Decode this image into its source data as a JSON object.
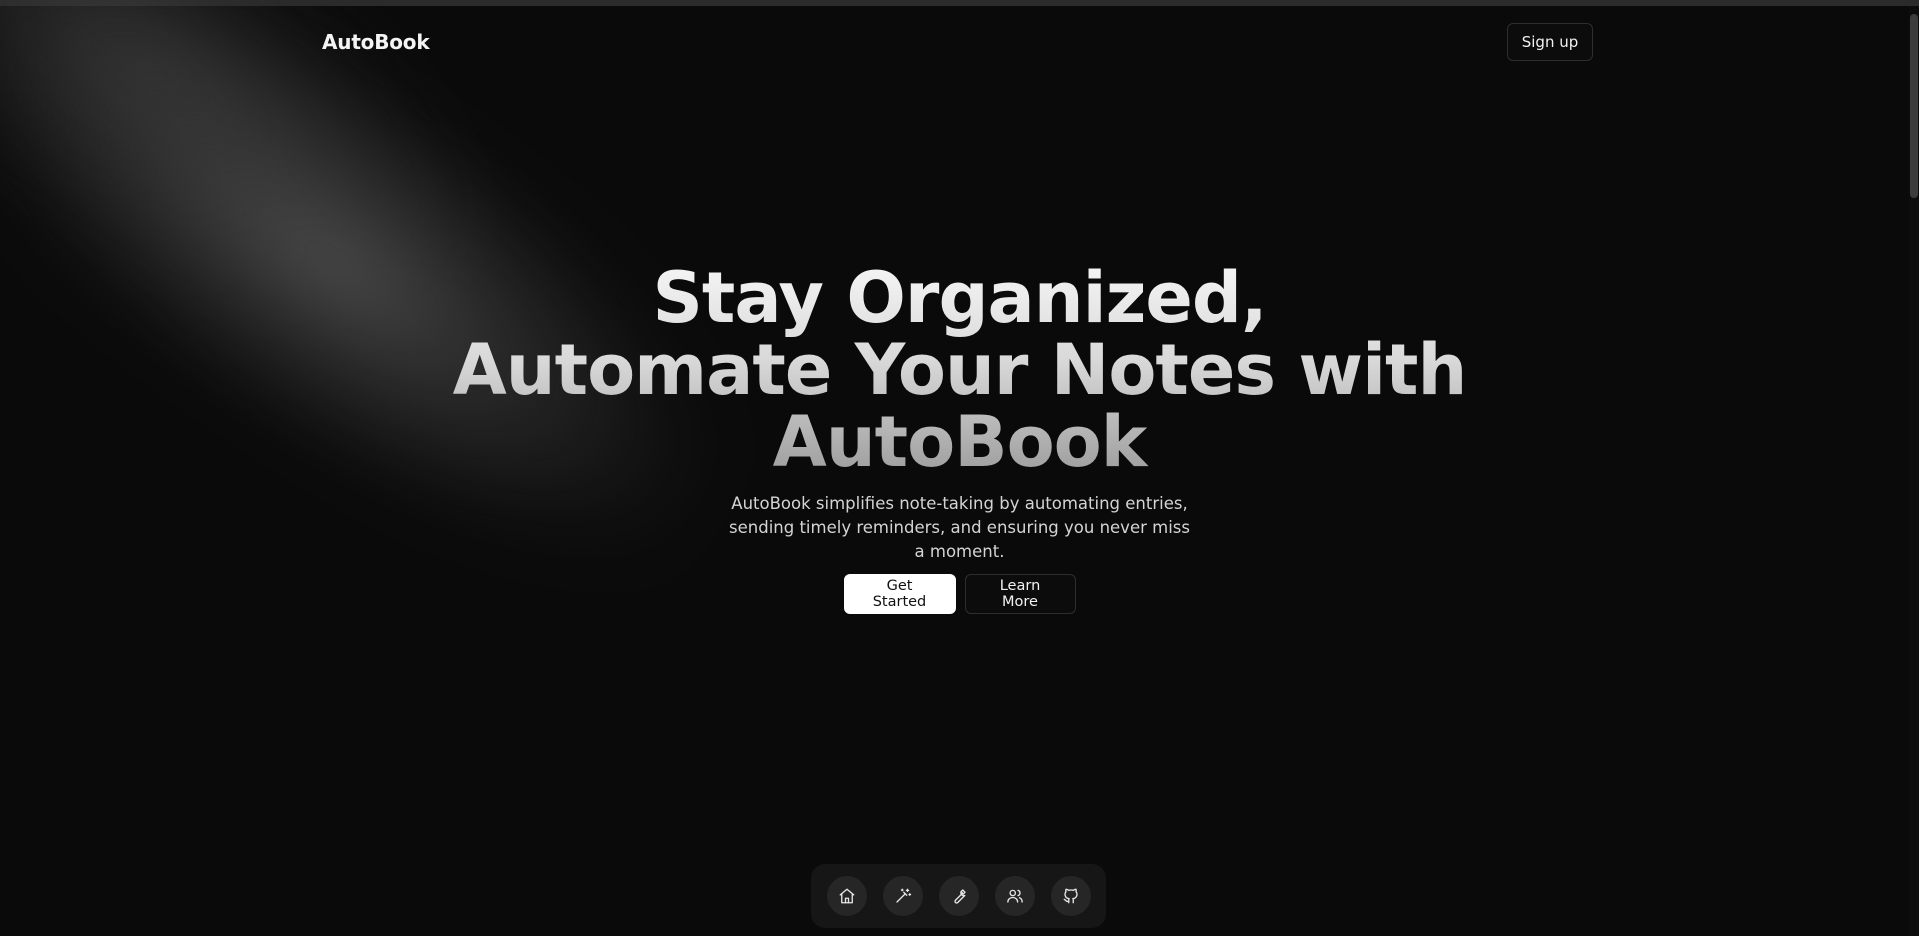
{
  "header": {
    "brand": "AutoBook",
    "signup_label": "Sign up"
  },
  "hero": {
    "headline_line1": "Stay Organized,",
    "headline_line2": "Automate Your Notes with",
    "headline_line3": "AutoBook",
    "subtitle": "AutoBook simplifies note-taking by automating entries, sending timely reminders, and ensuring you never miss a moment.",
    "primary_cta": "Get Started",
    "secondary_cta": "Learn More"
  },
  "dock": {
    "items": [
      {
        "icon": "home-icon"
      },
      {
        "icon": "magic-wand-icon"
      },
      {
        "icon": "wrench-icon"
      },
      {
        "icon": "users-icon"
      },
      {
        "icon": "github-icon"
      }
    ]
  },
  "colors": {
    "background": "#0a0a0a",
    "primary_button": "#ffffff",
    "dock_background": "#161616"
  }
}
